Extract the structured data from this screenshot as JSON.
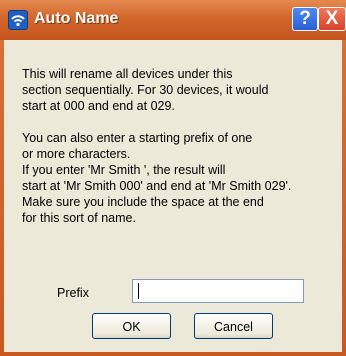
{
  "window": {
    "title": "Auto Name",
    "help_glyph": "?",
    "close_glyph": "X"
  },
  "dialog": {
    "message": "This will rename all devices under this\nsection sequentially. For 30 devices, it would\nstart at 000 and end at 029.\n\nYou can also enter a starting prefix of one\nor more characters.\nIf you enter 'Mr Smith ', the result will\nstart at 'Mr Smith 000' and end at 'Mr Smith 029'.\nMake sure you include the space at the end\nfor this sort of name.",
    "prefix_label": "Prefix",
    "prefix_value": "",
    "ok_label": "OK",
    "cancel_label": "Cancel"
  },
  "icons": {
    "title_icon": "wifi-icon"
  },
  "colors": {
    "titlebar": "#d2662b",
    "client_bg": "#ece9d8",
    "help_button": "#2a5fd6",
    "close_button": "#d7422a"
  }
}
